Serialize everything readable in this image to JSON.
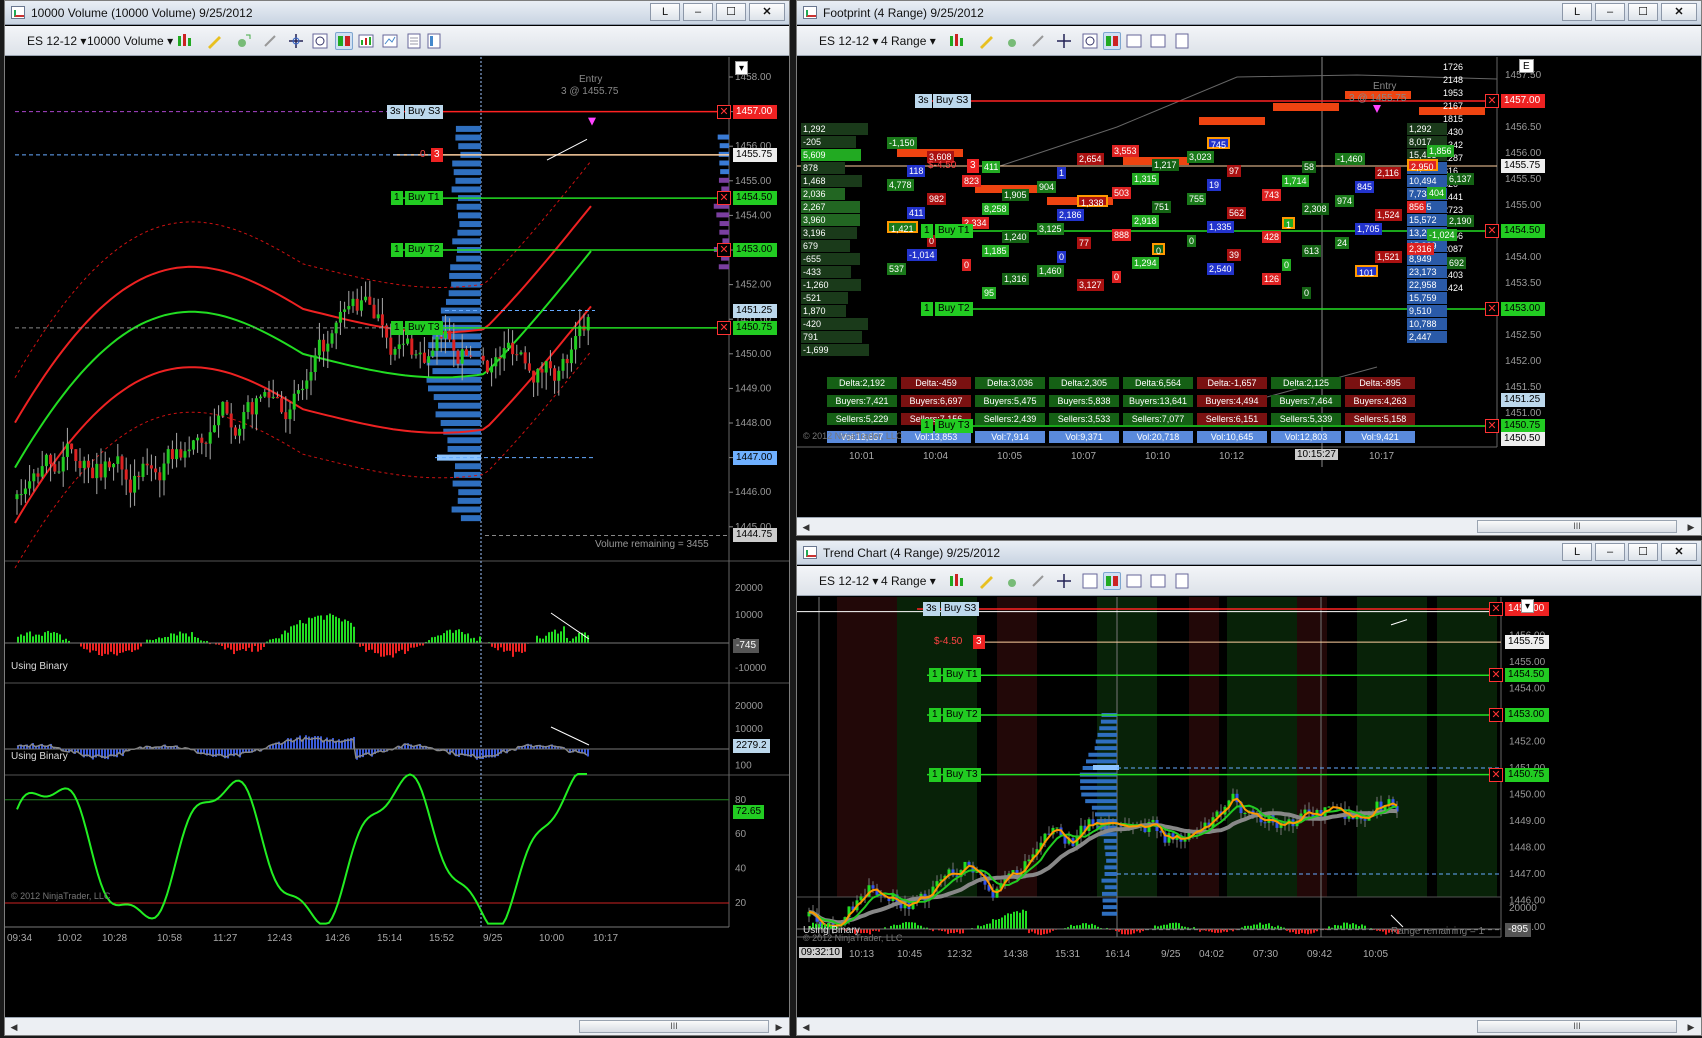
{
  "window_left": {
    "title": "10000 Volume (10000 Volume)  9/25/2012",
    "controls": {
      "l": "L",
      "min": "–",
      "max": "☐",
      "close": "✕"
    },
    "instrument": "ES 12-12",
    "interval": "10000 Volume",
    "order_tags": {
      "s3_qty": "3s",
      "s3_label": "Buy S3",
      "t1_qty": "1",
      "t1_label": "Buy T1",
      "t2_qty": "1",
      "t2_label": "Buy T2",
      "t3_qty": "1",
      "t3_label": "Buy T3",
      "pos_qty": "0",
      "pos_count": "3"
    },
    "entry_label": "Entry",
    "entry_detail": "3 @ 1455.75",
    "price_axis": [
      "1458.00",
      "1457.00",
      "1456.00",
      "1455.00",
      "1454.00",
      "1453.00",
      "1452.00",
      "1451.00",
      "1450.00",
      "1449.00",
      "1448.00",
      "1447.00",
      "1446.00",
      "1445.00"
    ],
    "price_tags": {
      "p1457": "1457.00",
      "p1455_75": "1455.75",
      "p1454_50": "1454.50",
      "p1453": "1453.00",
      "p1451_25": "1451.25",
      "p1450_75": "1450.75",
      "p1447": "1447.00",
      "p1444_75": "1444.75"
    },
    "volume_remaining": "Volume remaining = 3455",
    "ind1": {
      "label": "Using Binary",
      "axis": [
        "20000",
        "10000",
        "0",
        "-10000"
      ],
      "value": "-745"
    },
    "ind2": {
      "label": "Using Binary",
      "axis": [
        "20000",
        "10000",
        "0"
      ],
      "value": "2279.2"
    },
    "ind3": {
      "axis": [
        "100",
        "80",
        "60",
        "40",
        "20"
      ],
      "value": "72.65"
    },
    "copyright": "© 2012 NinjaTrader, LLC",
    "time_axis": [
      "09:34",
      "10:02",
      "10:28",
      "10:58",
      "11:27",
      "12:43",
      "14:26",
      "15:14",
      "15:52",
      "9/25",
      "10:00",
      "10:17"
    ]
  },
  "window_footprint": {
    "title": "Footprint (4 Range)  9/25/2012",
    "instrument": "ES 12-12",
    "interval": "4 Range",
    "order_tags": {
      "s3_qty": "3s",
      "s3_label": "Buy S3",
      "t1_qty": "1",
      "t1_label": "Buy T1",
      "t2_qty": "1",
      "t2_label": "Buy T2",
      "t3_qty": "1",
      "t3_label": "Buy T3",
      "pnl": "$-4.50",
      "pos_count": "3"
    },
    "entry_label": "Entry",
    "entry_detail": "3 @ 1455.75",
    "left_profile": [
      "1,292",
      "-205",
      "5,609",
      "878",
      "1,468",
      "2,036",
      "2,267",
      "3,960",
      "3,196",
      "679",
      "-655",
      "-433",
      "-1,260",
      "-521",
      "1,870",
      "-420",
      "791",
      "-1,699"
    ],
    "right_profile_a": [
      "1726",
      "2148",
      "1953",
      "2167",
      "1815",
      "1430",
      "1342",
      "1287",
      "316",
      "620",
      "1441",
      "2723",
      "1990",
      "2856",
      "2087",
      "1701",
      "1403",
      "1424"
    ],
    "right_profile_b": [
      "1,292",
      "8,017",
      "15,465",
      "15,366",
      "10,494",
      "7,734",
      "6,005",
      "15,572",
      "13,202",
      "15,889",
      "8,949",
      "23,173",
      "22,958",
      "15,759",
      "9,510",
      "10,788",
      "2,447"
    ],
    "delta": [
      "Delta:2,192",
      "Delta:-459",
      "Delta:3,036",
      "Delta:2,305",
      "Delta:6,564",
      "Delta:-1,657",
      "Delta:2,125",
      "Delta:-895"
    ],
    "buyers": [
      "Buyers:7,421",
      "Buyers:6,697",
      "Buyers:5,475",
      "Buyers:5,838",
      "Buyers:13,641",
      "Buyers:4,494",
      "Buyers:7,464",
      "Buyers:4,263"
    ],
    "sellers": [
      "Sellers:5,229",
      "Sellers:7,156",
      "Sellers:2,439",
      "Sellers:3,533",
      "Sellers:7,077",
      "Sellers:6,151",
      "Sellers:5,339",
      "Sellers:5,158"
    ],
    "vol": [
      "Vol:13,657",
      "Vol:13,853",
      "Vol:7,914",
      "Vol:9,371",
      "Vol:20,718",
      "Vol:10,645",
      "Vol:12,803",
      "Vol:9,421"
    ],
    "price_axis": [
      "1457.50",
      "1457.00",
      "1456.50",
      "1456.00",
      "1455.50",
      "1455.00",
      "1454.50",
      "1454.00",
      "1453.50",
      "1453.00",
      "1452.50",
      "1452.00",
      "1451.50",
      "1451.00",
      "1450.50"
    ],
    "price_tags": {
      "p1457": "1457.00",
      "p1455_75": "1455.75",
      "p1454_50": "1454.50",
      "p1453": "1453.00",
      "p1451_25": "1451.25",
      "p1450_75": "1450.75",
      "p1450_50": "1450.50"
    },
    "time_axis": [
      "10:01",
      "10:04",
      "10:05",
      "10:07",
      "10:10",
      "10:12",
      "10:15:27",
      "10:17"
    ],
    "copyright": "© 2012 NinjaTrader, LLC",
    "cells": [
      "-1,150",
      "411",
      "2,654",
      "3,553",
      "745",
      "58",
      "-1,460",
      "1,856",
      "3,608",
      "823",
      "1",
      "1,217",
      "3,023",
      "1,714",
      "2,116",
      "2,950",
      "118",
      "1,905",
      "904",
      "1,315",
      "97",
      "743",
      "845",
      "6,137",
      "4,778",
      "8,258",
      "1,338",
      "503",
      "19",
      "2,308",
      "974",
      "404",
      "982",
      "2,334",
      "2,186",
      "751",
      "755",
      "1",
      "1,524",
      "856",
      "411",
      "1,240",
      "3,125",
      "2,918",
      "562",
      "428",
      "1,705",
      "2,190",
      "1,421",
      "1,185",
      "77",
      "888",
      "1,335",
      "613",
      "24",
      "-1,024",
      "0",
      "0",
      "0",
      "0",
      "0",
      "0",
      "1,521",
      "2,316",
      "-1,014",
      "1,316",
      "1,460",
      "1,294",
      "39",
      "126",
      "101",
      "692",
      "537",
      "95",
      "3,127",
      "0",
      "2,540",
      "0"
    ]
  },
  "window_trend": {
    "title": "Trend Chart (4 Range)  9/25/2012",
    "instrument": "ES 12-12",
    "interval": "4 Range",
    "order_tags": {
      "s3_qty": "3s",
      "s3_label": "Buy S3",
      "t1_qty": "1",
      "t1_label": "Buy T1",
      "t2_qty": "1",
      "t2_label": "Buy T2",
      "t3_qty": "1",
      "t3_label": "Buy T3",
      "pnl": "$-4.50",
      "pos_count": "3"
    },
    "price_axis": [
      "1457.00",
      "1456.00",
      "1455.00",
      "1454.00",
      "1453.00",
      "1452.00",
      "1451.00",
      "1450.00",
      "1449.00",
      "1448.00",
      "1447.00",
      "1446.00",
      "1445.00"
    ],
    "price_tags": {
      "p1457": "1457.00",
      "p1455_75": "1455.75",
      "p1454_50": "1454.50",
      "p1453": "1453.00",
      "p1450_75": "1450.75"
    },
    "range_remaining": "Range remaining = 1",
    "ind": {
      "label": "Using Binary",
      "axis": [
        "20000"
      ],
      "value": "-895"
    },
    "copyright": "© 2012 NinjaTrader, LLC",
    "time_axis": [
      "09:32:10",
      "10:13",
      "10:45",
      "12:32",
      "14:38",
      "15:31",
      "16:14",
      "9/25",
      "04:02",
      "07:30",
      "09:42",
      "10:05"
    ]
  },
  "colors": {
    "green": "#00cc00",
    "red": "#ff2020",
    "blue": "#3a7bd5",
    "orange": "#ff9900",
    "bg": "#000000"
  }
}
